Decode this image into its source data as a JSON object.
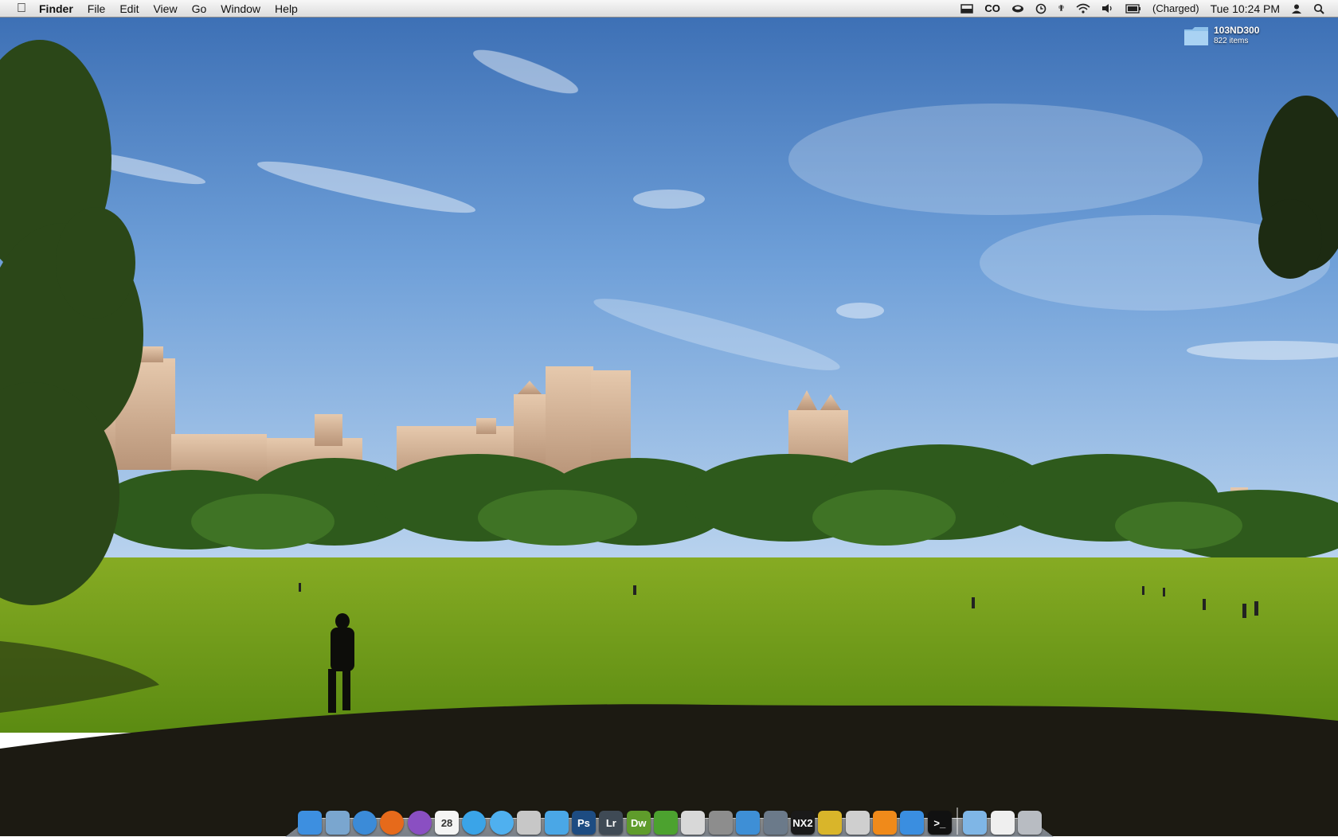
{
  "menubar": {
    "apple_icon": "apple-logo-icon",
    "app_name": "Finder",
    "menus": [
      "File",
      "Edit",
      "View",
      "Go",
      "Window",
      "Help"
    ],
    "status": {
      "battery_text": "(Charged)",
      "clock": "Tue 10:24 PM"
    },
    "status_icons": [
      "display-icon",
      "cd-icon",
      "cup-icon",
      "time-machine-icon",
      "bluetooth-icon",
      "wifi-icon",
      "volume-icon",
      "battery-icon",
      "user-icon",
      "spotlight-icon"
    ]
  },
  "desktop": {
    "wallpaper": "Central Park Sheep Meadow with city skyline",
    "folder": {
      "name": "103ND300",
      "count": "822 items",
      "icon": "folder-icon"
    }
  },
  "dock": {
    "items": [
      {
        "name": "finder-icon",
        "label": "",
        "color": "#3d8fe0"
      },
      {
        "name": "preview-icon",
        "label": "",
        "color": "#7aa6cf"
      },
      {
        "name": "safari-icon",
        "label": "",
        "color": "#3b8bd8"
      },
      {
        "name": "firefox-icon",
        "label": "",
        "color": "#e66a1b"
      },
      {
        "name": "itunes-icon",
        "label": "",
        "color": "#8a4fc2"
      },
      {
        "name": "calendar-icon",
        "label": "28",
        "color": "#f4f4f4"
      },
      {
        "name": "messenger-icon",
        "label": "",
        "color": "#3aa4e8"
      },
      {
        "name": "ichat-icon",
        "label": "",
        "color": "#4fb0ef"
      },
      {
        "name": "photo-icon",
        "label": "",
        "color": "#c7c7c7"
      },
      {
        "name": "itunes-note-icon",
        "label": "",
        "color": "#4aa7e6"
      },
      {
        "name": "photoshop-icon",
        "label": "Ps",
        "color": "#1d4c82"
      },
      {
        "name": "lightroom-icon",
        "label": "Lr",
        "color": "#3f4a55"
      },
      {
        "name": "dreamweaver-icon",
        "label": "Dw",
        "color": "#5f9c2b"
      },
      {
        "name": "leaf-icon",
        "label": "",
        "color": "#4ca22f"
      },
      {
        "name": "cs-icon",
        "label": "",
        "color": "#d8d8d8"
      },
      {
        "name": "settings-icon",
        "label": "",
        "color": "#8d8d8d"
      },
      {
        "name": "chart-app-icon",
        "label": "",
        "color": "#3e8fd6"
      },
      {
        "name": "quill-icon",
        "label": "",
        "color": "#6b7a8a"
      },
      {
        "name": "nx2-icon",
        "label": "NX2",
        "color": "#1a1a1a"
      },
      {
        "name": "camera-icon",
        "label": "",
        "color": "#d9b52a"
      },
      {
        "name": "dvd-icon",
        "label": "",
        "color": "#cfcfcf"
      },
      {
        "name": "vlc-icon",
        "label": "",
        "color": "#f08a1a"
      },
      {
        "name": "xcode-icon",
        "label": "",
        "color": "#3a8ee0"
      },
      {
        "name": "terminal-icon",
        "label": ">_",
        "color": "#111111"
      },
      {
        "name": "folder-stack-icon",
        "label": "",
        "color": "#7fb6e6"
      },
      {
        "name": "document-icon",
        "label": "",
        "color": "#efefef"
      },
      {
        "name": "trash-icon",
        "label": "",
        "color": "#b8bcc2"
      }
    ]
  },
  "colors": {
    "sky_top": "#3b6fb4",
    "sky_bottom": "#b9d3ee",
    "grass": "#6b9a16",
    "menubar": "#e9e9e9"
  }
}
